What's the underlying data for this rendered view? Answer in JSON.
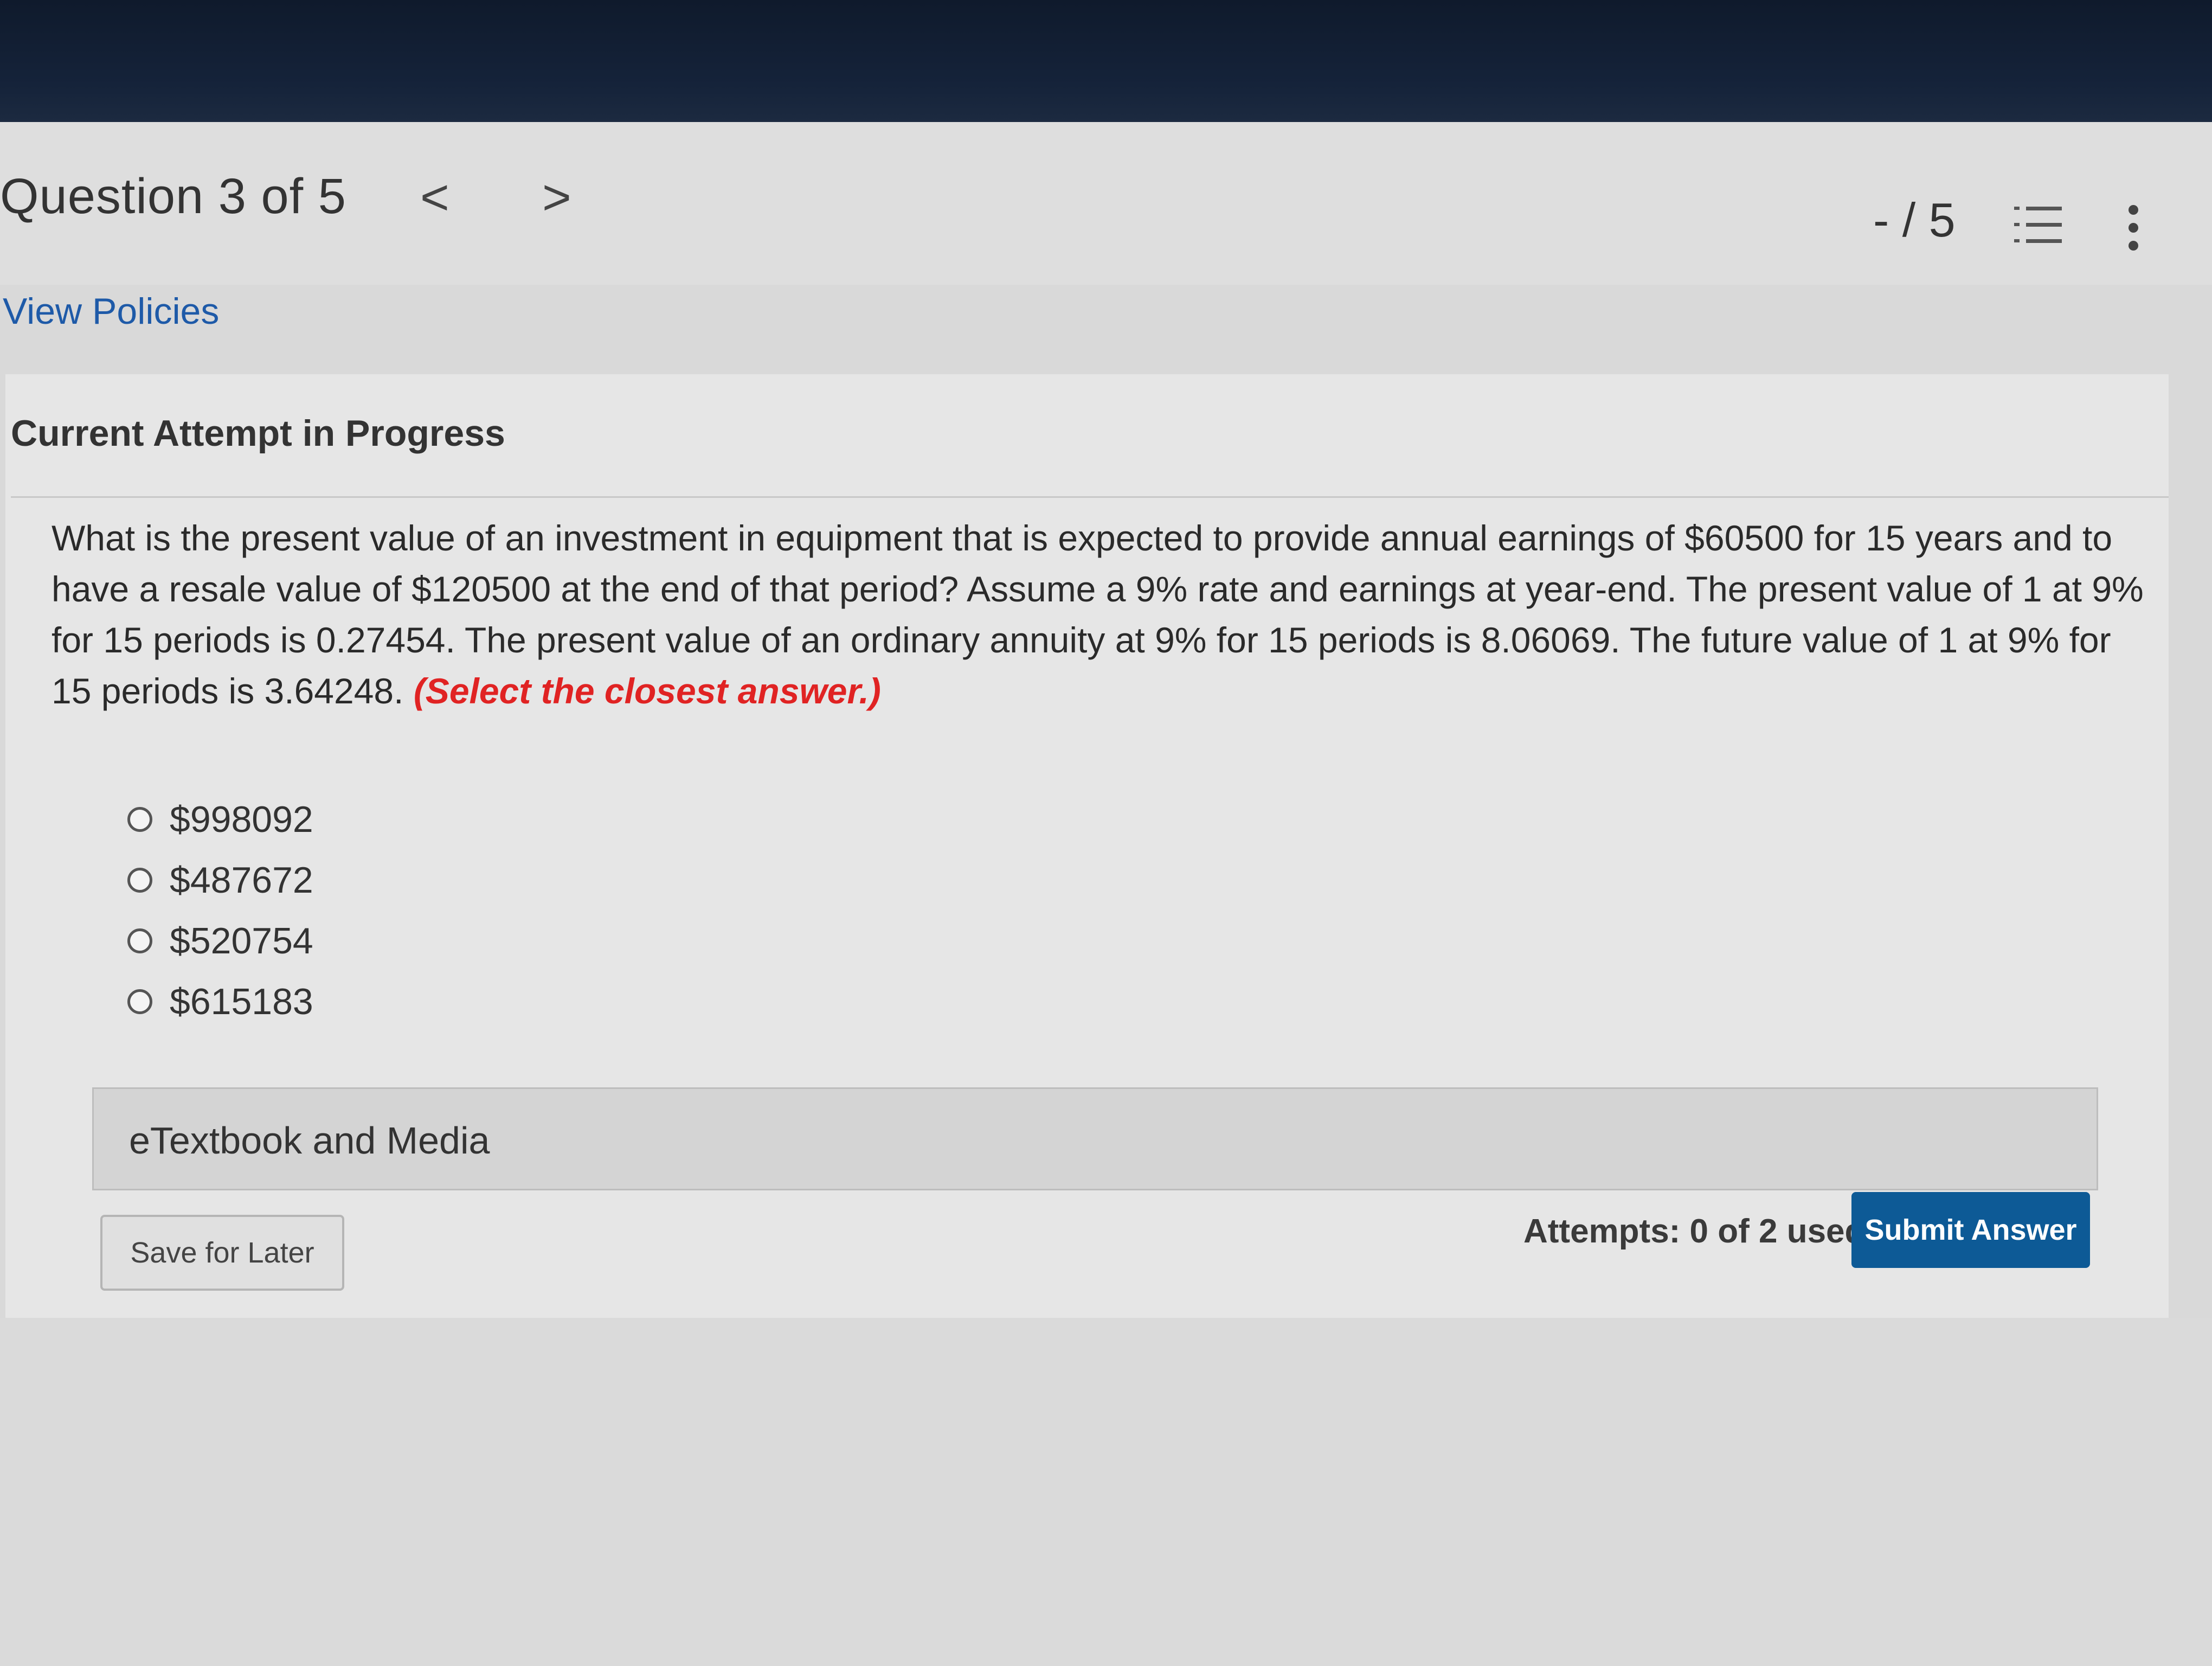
{
  "header": {
    "question_title": "Question 3 of 5",
    "prev_symbol": "<",
    "next_symbol": ">",
    "score": "- / 5"
  },
  "links": {
    "view_policies": "View Policies"
  },
  "attempt": {
    "heading": "Current Attempt in Progress"
  },
  "question": {
    "text": "What is the present value of an investment in equipment that is expected to provide annual earnings of $60500 for 15 years and to have a resale value of $120500 at the end of that period? Assume a 9% rate and earnings at year-end. The present value of 1 at 9% for 15 periods is 0.27454. The present value of an ordinary annuity at 9% for 15 periods is 8.06069. The future value of 1 at 9% for 15 periods is 3.64248.",
    "hint": "(Select the closest answer.)"
  },
  "options": [
    {
      "label": "$998092"
    },
    {
      "label": "$487672"
    },
    {
      "label": "$520754"
    },
    {
      "label": "$615183"
    }
  ],
  "resources": {
    "etextbook_label": "eTextbook and Media"
  },
  "footer": {
    "save_label": "Save for Later",
    "attempts_text": "Attempts: 0 of 2 used",
    "submit_label": "Submit Answer"
  },
  "icons": {
    "prev": "chevron-left-icon",
    "next": "chevron-right-icon",
    "list": "numbered-list-icon",
    "more": "more-vertical-icon"
  },
  "colors": {
    "link": "#1e5aa8",
    "hint": "#e02323",
    "submit": "#0d5a96",
    "topbar": "#15233a"
  }
}
